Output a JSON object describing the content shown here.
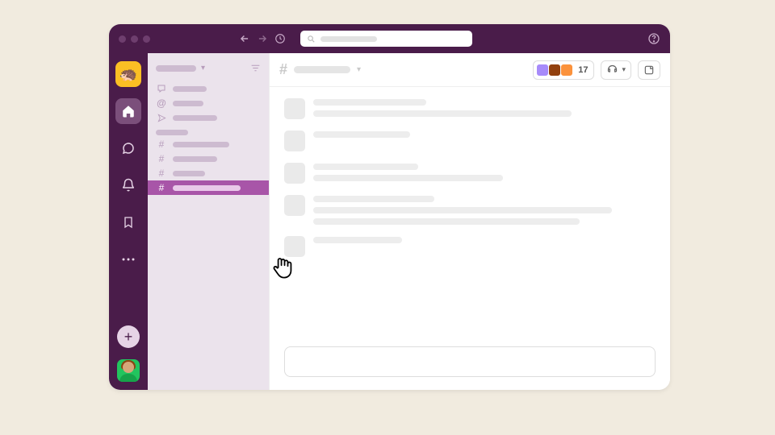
{
  "colors": {
    "brand": "#4A1C4A",
    "accent": "#A855A8",
    "workspace_badge": "#FBBF24"
  },
  "titlebar": {
    "back_icon": "chevron-left",
    "forward_icon": "chevron-right",
    "history_icon": "clock",
    "search_placeholder": "",
    "help_icon": "help"
  },
  "rail": {
    "workspace_emoji": "🦔",
    "home_label": "Home",
    "dms_label": "DMs",
    "activity_label": "Activity",
    "later_label": "Later",
    "more_label": "More",
    "add_label": "+"
  },
  "sidebar": {
    "workspace_name": "",
    "nav_items": [
      {
        "icon": "message",
        "width": 42
      },
      {
        "icon": "mention",
        "width": 38
      },
      {
        "icon": "send",
        "width": 55
      }
    ],
    "channels_section_label": "",
    "channels": [
      {
        "name": "",
        "width": 70,
        "selected": false
      },
      {
        "name": "",
        "width": 55,
        "selected": false
      },
      {
        "name": "",
        "width": 40,
        "selected": false
      },
      {
        "name": "",
        "width": 84,
        "selected": true
      }
    ]
  },
  "channel": {
    "hash": "#",
    "name": "",
    "member_count": "17",
    "huddle_icon": "headphones",
    "canvas_icon": "canvas"
  },
  "messages": [
    {
      "lines": [
        140,
        320
      ]
    },
    {
      "lines": [
        120
      ]
    },
    {
      "lines": [
        130,
        235
      ]
    },
    {
      "lines": [
        150,
        370,
        330
      ]
    },
    {
      "lines": [
        110
      ]
    }
  ],
  "composer": {
    "placeholder": ""
  }
}
